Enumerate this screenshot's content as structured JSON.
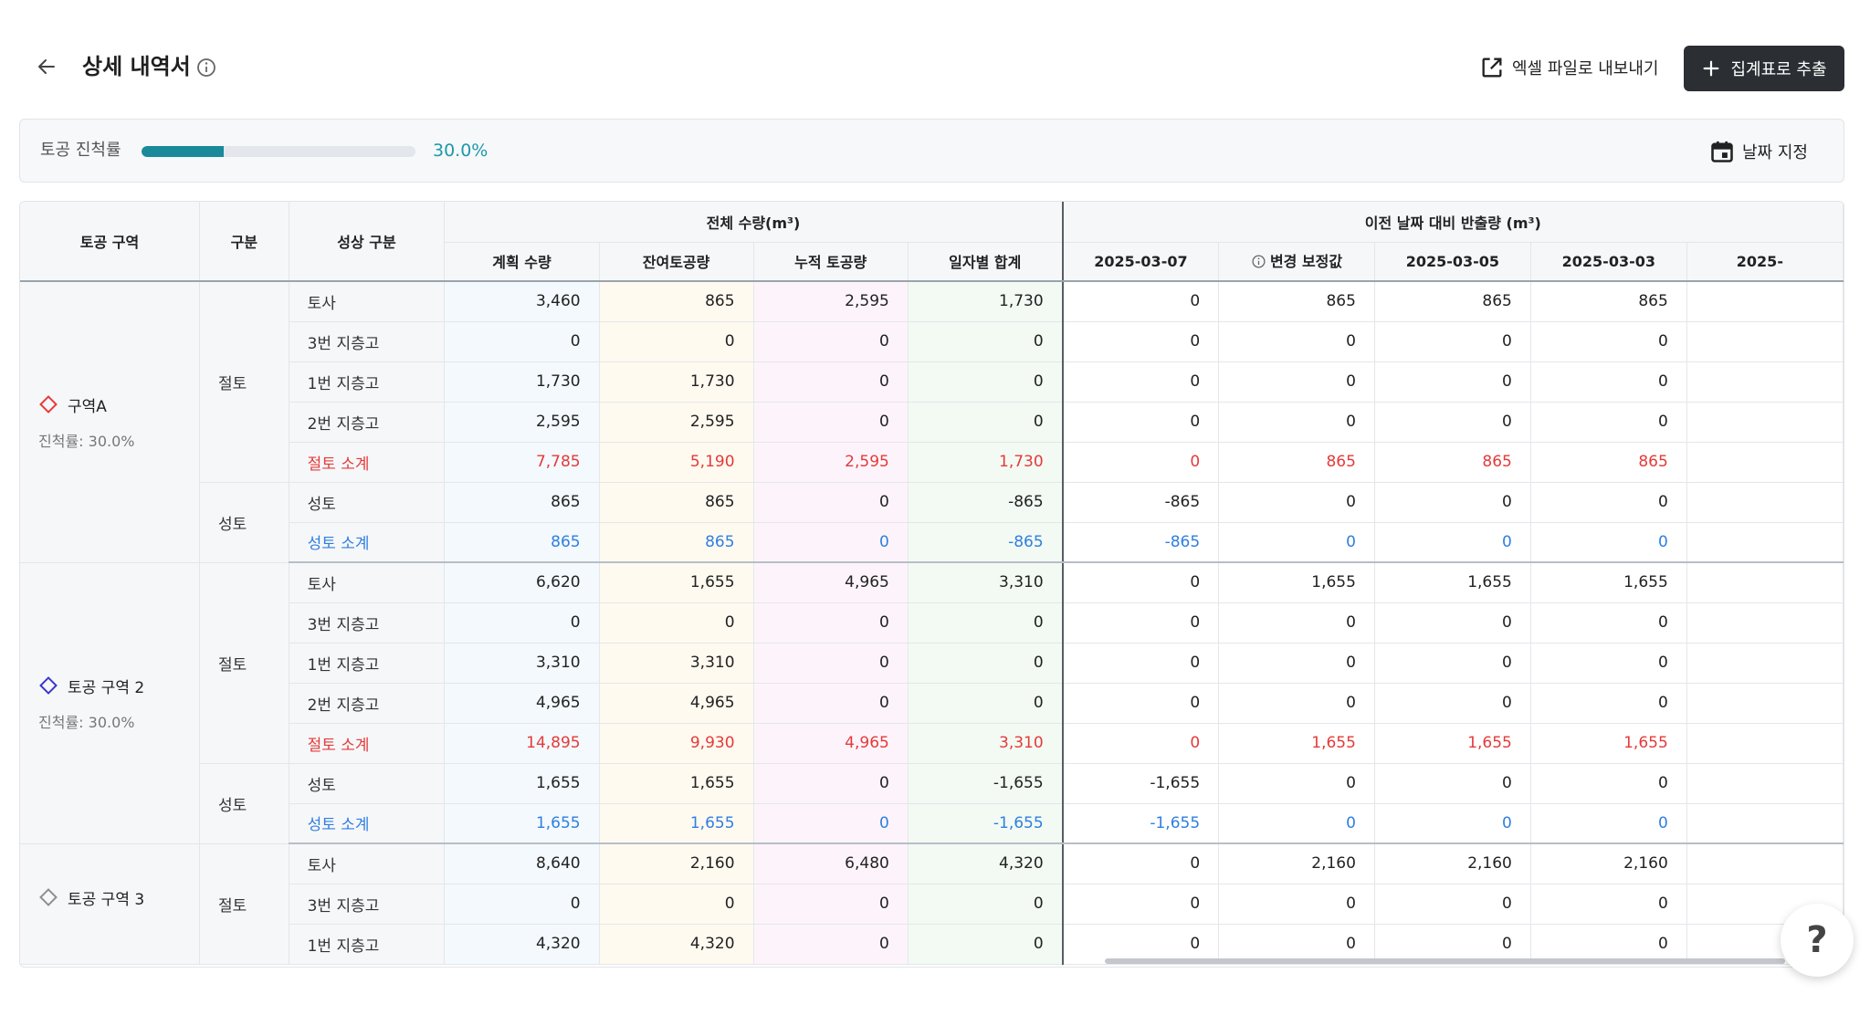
{
  "header": {
    "title": "상세 내역서",
    "export_label": "엑셀 파일로 내보내기",
    "extract_label": "집계표로 추출"
  },
  "progress": {
    "label": "토공 진척률",
    "value": 30.0,
    "value_text": "30.0%",
    "date_label": "날짜 지정"
  },
  "table": {
    "headers": {
      "zone": "토공 구역",
      "kind": "구분",
      "state": "성상 구분",
      "total_group": "전체 수량(m³)",
      "prev_group": "이전 날짜 대비 반출량 (m³)",
      "plan": "계획 수량",
      "remaining": "잔여토공량",
      "accum": "누적 토공량",
      "daily": "일자별 합계",
      "d1": "2025-03-07",
      "d2": "변경 보정값",
      "d3": "2025-03-05",
      "d4": "2025-03-03",
      "d5": "2025-"
    },
    "zones": [
      {
        "name": "구역A",
        "rate": "진척률: 30.0%",
        "color": "#e53a3a",
        "cut_label": "절토",
        "fill_label": "성토",
        "rows": [
          {
            "label": "토사",
            "cells": [
              "3,460",
              "865",
              "2,595",
              "1,730",
              "0",
              "865",
              "865",
              "865",
              ""
            ]
          },
          {
            "label": "3번 지층고",
            "cells": [
              "0",
              "0",
              "0",
              "0",
              "0",
              "0",
              "0",
              "0",
              ""
            ]
          },
          {
            "label": "1번 지층고",
            "cells": [
              "1,730",
              "1,730",
              "0",
              "0",
              "0",
              "0",
              "0",
              "0",
              ""
            ]
          },
          {
            "label": "2번 지층고",
            "cells": [
              "2,595",
              "2,595",
              "0",
              "0",
              "0",
              "0",
              "0",
              "0",
              ""
            ]
          },
          {
            "label": "절토 소계",
            "cells": [
              "7,785",
              "5,190",
              "2,595",
              "1,730",
              "0",
              "865",
              "865",
              "865",
              ""
            ]
          },
          {
            "label": "성토",
            "cells": [
              "865",
              "865",
              "0",
              "-865",
              "-865",
              "0",
              "0",
              "0",
              ""
            ]
          },
          {
            "label": "성토 소계",
            "cells": [
              "865",
              "865",
              "0",
              "-865",
              "-865",
              "0",
              "0",
              "0",
              ""
            ]
          }
        ]
      },
      {
        "name": "토공 구역 2",
        "rate": "진척률: 30.0%",
        "color": "#3a36c9",
        "cut_label": "절토",
        "fill_label": "성토",
        "rows": [
          {
            "label": "토사",
            "cells": [
              "6,620",
              "1,655",
              "4,965",
              "3,310",
              "0",
              "1,655",
              "1,655",
              "1,655",
              ""
            ]
          },
          {
            "label": "3번 지층고",
            "cells": [
              "0",
              "0",
              "0",
              "0",
              "0",
              "0",
              "0",
              "0",
              ""
            ]
          },
          {
            "label": "1번 지층고",
            "cells": [
              "3,310",
              "3,310",
              "0",
              "0",
              "0",
              "0",
              "0",
              "0",
              ""
            ]
          },
          {
            "label": "2번 지층고",
            "cells": [
              "4,965",
              "4,965",
              "0",
              "0",
              "0",
              "0",
              "0",
              "0",
              ""
            ]
          },
          {
            "label": "절토 소계",
            "cells": [
              "14,895",
              "9,930",
              "4,965",
              "3,310",
              "0",
              "1,655",
              "1,655",
              "1,655",
              ""
            ]
          },
          {
            "label": "성토",
            "cells": [
              "1,655",
              "1,655",
              "0",
              "-1,655",
              "-1,655",
              "0",
              "0",
              "0",
              ""
            ]
          },
          {
            "label": "성토 소계",
            "cells": [
              "1,655",
              "1,655",
              "0",
              "-1,655",
              "-1,655",
              "0",
              "0",
              "0",
              ""
            ]
          }
        ]
      },
      {
        "name": "토공 구역 3",
        "rate": "",
        "color": "#8a8f96",
        "cut_label": "절토",
        "fill_label": "",
        "rows": [
          {
            "label": "토사",
            "cells": [
              "8,640",
              "2,160",
              "6,480",
              "4,320",
              "0",
              "2,160",
              "2,160",
              "2,160",
              ""
            ]
          },
          {
            "label": "3번 지층고",
            "cells": [
              "0",
              "0",
              "0",
              "0",
              "0",
              "0",
              "0",
              "0",
              ""
            ]
          },
          {
            "label": "1번 지층고",
            "cells": [
              "4,320",
              "4,320",
              "0",
              "0",
              "0",
              "0",
              "0",
              "0",
              ""
            ]
          }
        ]
      }
    ]
  },
  "help_label": "?"
}
